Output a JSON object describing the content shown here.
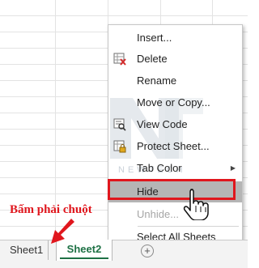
{
  "context_menu": {
    "items": [
      {
        "label": "Insert...",
        "icon": "none",
        "disabled": false
      },
      {
        "label": "Delete",
        "icon": "delete-sheet-icon",
        "disabled": false
      },
      {
        "label": "Rename",
        "icon": "none",
        "disabled": false
      },
      {
        "label": "Move or Copy...",
        "icon": "none",
        "disabled": false
      },
      {
        "label": "View Code",
        "icon": "view-code-icon",
        "disabled": false
      },
      {
        "label": "Protect Sheet...",
        "icon": "protect-sheet-icon",
        "disabled": false
      },
      {
        "label": "Tab Color",
        "icon": "none",
        "disabled": false,
        "submenu": true
      },
      {
        "label": "Hide",
        "icon": "none",
        "disabled": false,
        "highlighted": true
      },
      {
        "label": "Unhide...",
        "icon": "none",
        "disabled": true
      },
      {
        "label": "Select All Sheets",
        "icon": "none",
        "disabled": false
      }
    ]
  },
  "watermark": {
    "text": "NEWTECH"
  },
  "sheet_tabs": [
    {
      "label": "Sheet1",
      "active": false
    },
    {
      "label": "Sheet2",
      "active": true
    }
  ],
  "add_sheet_symbol": "+",
  "annotation": {
    "text": "Bấm phải chuột"
  },
  "colors": {
    "highlight": "#e0161d",
    "active_tab": "#1e7145",
    "menu_hover": "#b5b5b5"
  }
}
